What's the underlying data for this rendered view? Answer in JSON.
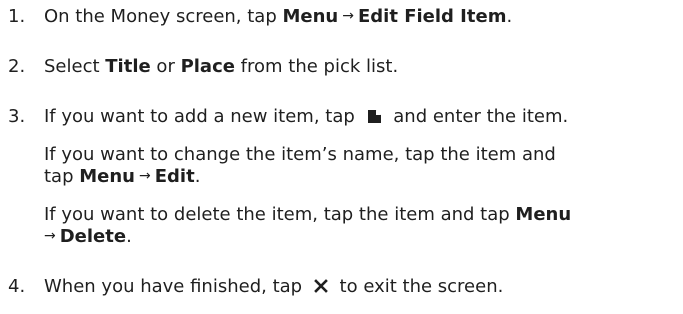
{
  "steps": [
    {
      "number": "1.",
      "text_before": "On the Money screen, tap ",
      "menu": "Menu",
      "arrow": "→",
      "item": "Edit Field Item",
      "end": "."
    },
    {
      "number": "2.",
      "text_before": "Select ",
      "option1": "Title",
      "text_or": " or ",
      "option2": "Place",
      "text_after": " from the pick list."
    },
    {
      "number": "3.",
      "text_before": "If you want to add a new item, tap ",
      "icon": "new-item-icon",
      "text_after": " and enter the item.",
      "notes": [
        {
          "line1": "If you want to change the item’s name, tap the item and",
          "line2_before": "tap ",
          "menu": "Menu",
          "arrow": "→",
          "item": "Edit",
          "end": "."
        },
        {
          "line1_before": "If you want to delete the item, tap the item and tap ",
          "menu": "Menu",
          "arrow": "→",
          "item": "Delete",
          "end": "."
        }
      ]
    },
    {
      "number": "4.",
      "text_before": "When you have finished, tap ",
      "icon": "close-icon",
      "text_after": " to exit the screen."
    }
  ]
}
